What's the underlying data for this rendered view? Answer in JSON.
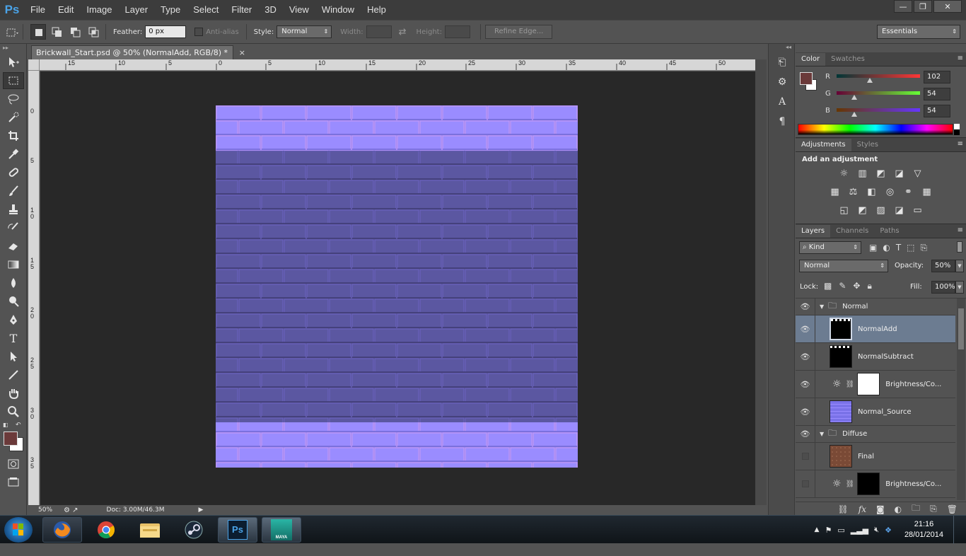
{
  "app": {
    "logo": "Ps"
  },
  "menu": [
    "File",
    "Edit",
    "Image",
    "Layer",
    "Type",
    "Select",
    "Filter",
    "3D",
    "View",
    "Window",
    "Help"
  ],
  "window_controls": {
    "minimize": "—",
    "restore": "❐",
    "close": "✕"
  },
  "options_bar": {
    "feather_label": "Feather:",
    "feather_value": "0 px",
    "antialias_label": "Anti-alias",
    "style_label": "Style:",
    "style_value": "Normal",
    "width_label": "Width:",
    "height_label": "Height:",
    "refine_edge": "Refine Edge...",
    "workspace": "Essentials"
  },
  "document": {
    "tab_title": "Brickwall_Start.psd @ 50% (NormalAdd, RGB/8) *",
    "close": "×",
    "ruler_h": [
      "15",
      "10",
      "5",
      "0",
      "5",
      "10",
      "15",
      "20",
      "25",
      "30",
      "35",
      "40",
      "45",
      "50"
    ],
    "ruler_v": [
      "0",
      "5",
      "1 0",
      "1 5",
      "2 0",
      "2 5",
      "3 0",
      "3 5"
    ],
    "zoom": "50%",
    "doc_size": "Doc: 3.00M/46.3M"
  },
  "color_panel": {
    "tabs": [
      "Color",
      "Swatches"
    ],
    "fg_color": "#6b3a3a",
    "bg_color": "#ffffff",
    "r_label": "R",
    "r_value": "102",
    "g_label": "G",
    "g_value": "54",
    "b_label": "B",
    "b_value": "54"
  },
  "adjustments_panel": {
    "tabs": [
      "Adjustments",
      "Styles"
    ],
    "heading": "Add an adjustment"
  },
  "layers_panel": {
    "tabs": [
      "Layers",
      "Channels",
      "Paths"
    ],
    "filter_kind": "Kind",
    "blend_mode": "Normal",
    "opacity_label": "Opacity:",
    "opacity_value": "50%",
    "lock_label": "Lock:",
    "fill_label": "Fill:",
    "fill_value": "100%",
    "layers": [
      {
        "name": "Normal",
        "type": "group",
        "visible": true
      },
      {
        "name": "NormalAdd",
        "type": "layer",
        "visible": true,
        "selected": true
      },
      {
        "name": "NormalSubtract",
        "type": "layer",
        "visible": true
      },
      {
        "name": "Brightness/Co...",
        "type": "adjustment",
        "visible": true
      },
      {
        "name": "Normal_Source",
        "type": "layer",
        "visible": true
      },
      {
        "name": "Diffuse",
        "type": "group",
        "visible": true
      },
      {
        "name": "Final",
        "type": "layer",
        "visible": false
      },
      {
        "name": "Brightness/Co...",
        "type": "adjustment",
        "visible": false
      }
    ]
  },
  "taskbar": {
    "apps": [
      {
        "name": "firefox-icon"
      },
      {
        "name": "chrome-icon"
      },
      {
        "name": "explorer-icon"
      },
      {
        "name": "steam-icon"
      },
      {
        "name": "photoshop-icon",
        "label": "Ps"
      },
      {
        "name": "maya-icon",
        "label": "MAYA"
      }
    ],
    "time": "21:16",
    "date": "28/01/2014"
  }
}
